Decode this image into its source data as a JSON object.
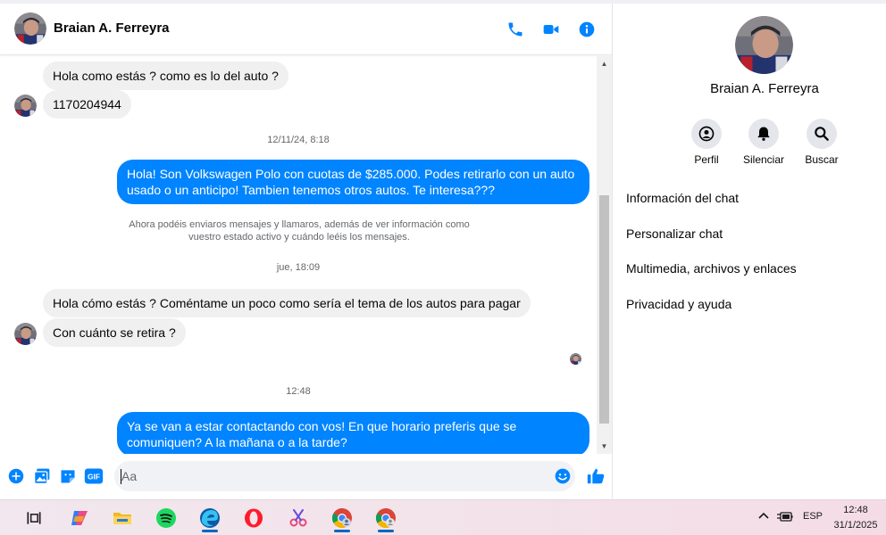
{
  "contact": {
    "name": "Braian A. Ferreyra"
  },
  "messages": [
    {
      "type": "in",
      "text": "Hola como estás ? como es lo del auto ?"
    },
    {
      "type": "in",
      "text": "1170204944"
    },
    {
      "type": "timestamp",
      "text": "12/11/24, 8:18"
    },
    {
      "type": "out",
      "text": "Hola! Son Volkswagen Polo con cuotas de $285.000. Podes retirarlo con un auto usado o un anticipo! Tambien tenemos otros autos. Te interesa???"
    },
    {
      "type": "system",
      "text": "Ahora podéis enviaros mensajes y llamaros, además de ver información como vuestro estado activo y cuándo leéis los mensajes."
    },
    {
      "type": "timestamp",
      "text": "jue, 18:09"
    },
    {
      "type": "in",
      "text": "Hola cómo estás ? Coméntame un poco como sería el tema de los autos para pagar"
    },
    {
      "type": "in",
      "text": "Con cuánto se retira ?"
    },
    {
      "type": "timestamp",
      "text": "12:48"
    },
    {
      "type": "out",
      "text": "Ya se van a estar contactando con vos! En que horario preferis que se comuniquen? A la mañana o a la tarde?"
    }
  ],
  "composer": {
    "placeholder": "Aa"
  },
  "details": {
    "actions": [
      {
        "label": "Perfil",
        "icon": "profile-icon"
      },
      {
        "label": "Silenciar",
        "icon": "bell-icon"
      },
      {
        "label": "Buscar",
        "icon": "search-icon"
      }
    ],
    "menu": [
      "Información del chat",
      "Personalizar chat",
      "Multimedia, archivos y enlaces",
      "Privacidad y ayuda"
    ]
  },
  "taskbar": {
    "language": "ESP",
    "time": "12:48",
    "date": "31/1/2025"
  },
  "colors": {
    "accent": "#0084ff",
    "incoming_bubble": "#f0f0f0",
    "muted_text": "#65676b"
  }
}
